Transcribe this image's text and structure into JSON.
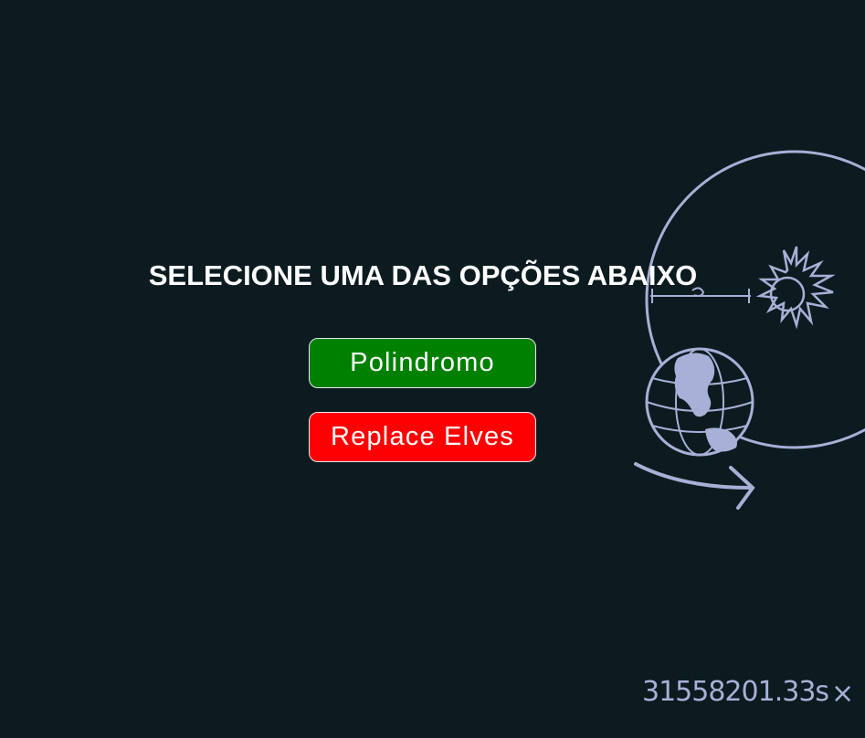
{
  "page": {
    "heading": "SELECIONE UMA DAS OPÇÕES ABAIXO",
    "buttons": {
      "palindrome_label": "Polindromo",
      "replace_elves_label": "Replace Elves"
    }
  },
  "overlay": {
    "elapsed_time": "31558201.33s",
    "close_glyph": "×"
  },
  "colors": {
    "background": "#0b1b20",
    "palindrome_button": "#008000",
    "replace_elves_button": "#ff0000",
    "illustration_stroke": "#a7b0d6"
  },
  "icons": [
    "sun-icon",
    "earth-globe-icon",
    "orbit-arrow-icon",
    "close-icon"
  ]
}
